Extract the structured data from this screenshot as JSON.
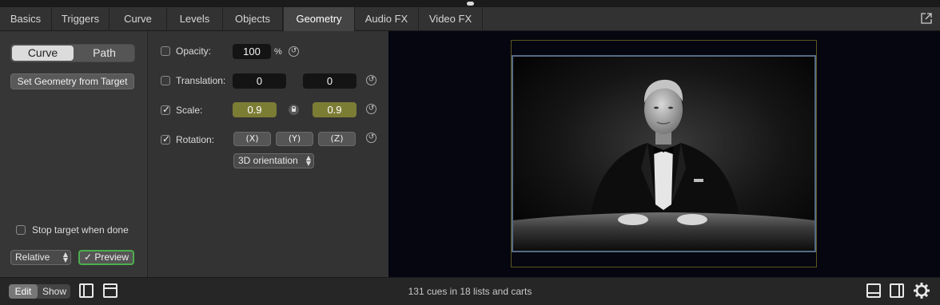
{
  "tabs": [
    "Basics",
    "Triggers",
    "Curve",
    "Levels",
    "Objects",
    "Geometry",
    "Audio FX",
    "Video FX"
  ],
  "active_tab": "Geometry",
  "left": {
    "segment": {
      "curve": "Curve",
      "path": "Path",
      "selected": "Curve"
    },
    "set_geometry_button": "Set Geometry from Target",
    "stop_target_label": "Stop target when done",
    "stop_target_checked": false,
    "mode_select": "Relative",
    "preview_button": "✓ Preview"
  },
  "geometry": {
    "opacity": {
      "label": "Opacity:",
      "value": "100",
      "unit": "%",
      "checked": false
    },
    "translation": {
      "label": "Translation:",
      "x": "0",
      "y": "0",
      "checked": false
    },
    "scale": {
      "label": "Scale:",
      "x": "0.9",
      "y": "0.9",
      "checked": true
    },
    "rotation": {
      "label": "Rotation:",
      "x_button": "(X)",
      "y_button": "(Y)",
      "z_button": "(Z)",
      "checked": true,
      "orientation_select": "3D orientation"
    }
  },
  "bottom": {
    "edit": "Edit",
    "show": "Show",
    "status": "131 cues in 18 lists and carts"
  },
  "colors": {
    "accent_green": "#4cae4c",
    "field_gold": "#7c7d35",
    "inner_frame": "#566b85",
    "outer_frame": "#5b5520"
  }
}
